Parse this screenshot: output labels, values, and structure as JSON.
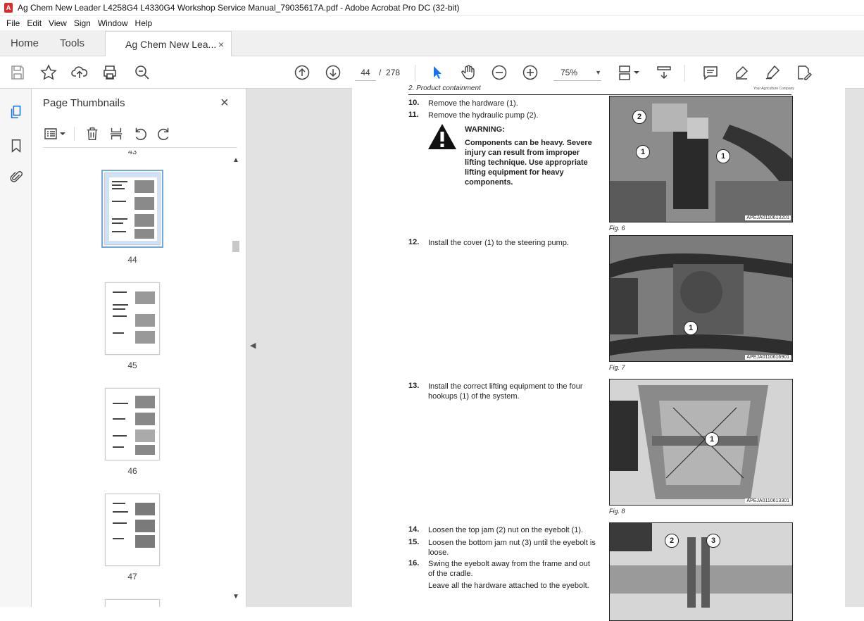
{
  "window": {
    "title": "Ag Chem New Leader L4258G4 L4330G4 Workshop Service Manual_79035617A.pdf - Adobe Acrobat Pro DC (32-bit)"
  },
  "menu": [
    "File",
    "Edit",
    "View",
    "Sign",
    "Window",
    "Help"
  ],
  "tabs": {
    "home": "Home",
    "tools": "Tools",
    "document": "Ag Chem New Lea...",
    "close_glyph": "×"
  },
  "toolbar": {
    "current_page": "44",
    "page_separator": "/",
    "total_pages": "278",
    "zoom": "75%",
    "icons": [
      "save-icon",
      "star-icon",
      "upload-icon",
      "print-icon",
      "zoom-search-icon",
      "page-up-icon",
      "page-down-icon",
      "select-arrow-icon",
      "hand-icon",
      "zoom-out-icon",
      "zoom-in-icon",
      "fit-page-icon",
      "scroll-mode-icon",
      "comment-icon",
      "highlight-icon",
      "sign-icon",
      "edit-pdf-icon"
    ]
  },
  "thumbnails": {
    "title": "Page Thumbnails",
    "top_partial_label": "43",
    "pages": [
      {
        "label": "44",
        "selected": true
      },
      {
        "label": "45",
        "selected": false
      },
      {
        "label": "46",
        "selected": false
      },
      {
        "label": "47",
        "selected": false
      }
    ]
  },
  "document": {
    "header_left": "2. Product containment",
    "header_right": "Your Agriculture Company",
    "steps": [
      {
        "num": "10.",
        "text": "Remove the hardware (1)."
      },
      {
        "num": "11.",
        "text": "Remove the hydraulic pump (2)."
      },
      {
        "num": "12.",
        "text": "Install the cover (1) to the steering pump."
      },
      {
        "num": "13.",
        "text": "Install the correct lifting equipment to the four hookups (1) of the system."
      },
      {
        "num": "14.",
        "text": "Loosen the top jam (2) nut on the eyebolt (1)."
      },
      {
        "num": "15.",
        "text": "Loosen the bottom jam nut (3) until the eyebolt is loose."
      },
      {
        "num": "16.",
        "text": "Swing the eyebolt away from the frame and out of the cradle."
      },
      {
        "num": "",
        "text": "Leave all the hardware attached to the eyebolt."
      }
    ],
    "warning": {
      "title": "WARNING:",
      "body": "Components can be heavy. Severe injury can result from improper lifting technique. Use appropriate lifting equipment for heavy components."
    },
    "figures": [
      {
        "caption": "Fig. 6",
        "code": "APEJA0110613201"
      },
      {
        "caption": "Fig. 7",
        "code": "APEJA0110616901"
      },
      {
        "caption": "Fig. 8",
        "code": "APEJA0110613301"
      }
    ],
    "callouts": [
      "1",
      "2",
      "3"
    ]
  }
}
